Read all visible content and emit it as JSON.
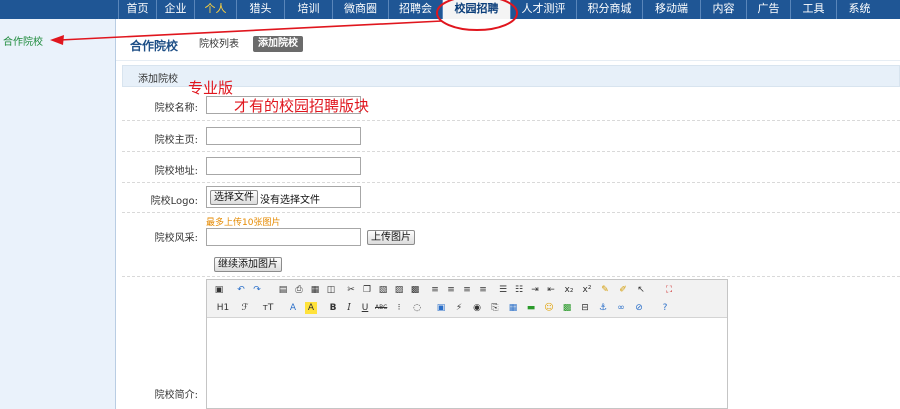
{
  "topnav": {
    "tabs": [
      "首页",
      "企业",
      "个人",
      "猎头",
      "培训",
      "微商圈",
      "招聘会",
      "校园招聘",
      "人才测评",
      "积分商城",
      "移动端",
      "内容",
      "广告",
      "工具",
      "系统"
    ]
  },
  "sidebar": {
    "items": [
      "合作院校"
    ]
  },
  "main": {
    "title": "合作院校",
    "subtabs": [
      "院校列表",
      "添加院校"
    ],
    "section_title": "添加院校"
  },
  "form": {
    "name_label": "院校名称:",
    "homepage_label": "院校主页:",
    "address_label": "院校地址:",
    "logo_label": "院校Logo:",
    "choose_file": "选择文件",
    "no_file": "没有选择文件",
    "style_label": "院校风采:",
    "upload_hint": "最多上传10张图片",
    "upload_button": "上传图片",
    "add_more_button": "继续添加图片",
    "intro_label": "院校简介:"
  },
  "annotations": {
    "pro_edition": "专业版",
    "exclusive_note": "才有的校园招聘版块"
  },
  "editor": {
    "toolbar_row2_text": [
      "H1",
      "ℱ",
      "тT",
      "A",
      "A",
      "B",
      "I",
      "U",
      "ABC"
    ]
  },
  "colors": {
    "nav_bg": "#1f5695",
    "annotation_red": "#e0161e",
    "sidebar_link": "#1c8a3a",
    "hint_orange": "#e58a00"
  }
}
